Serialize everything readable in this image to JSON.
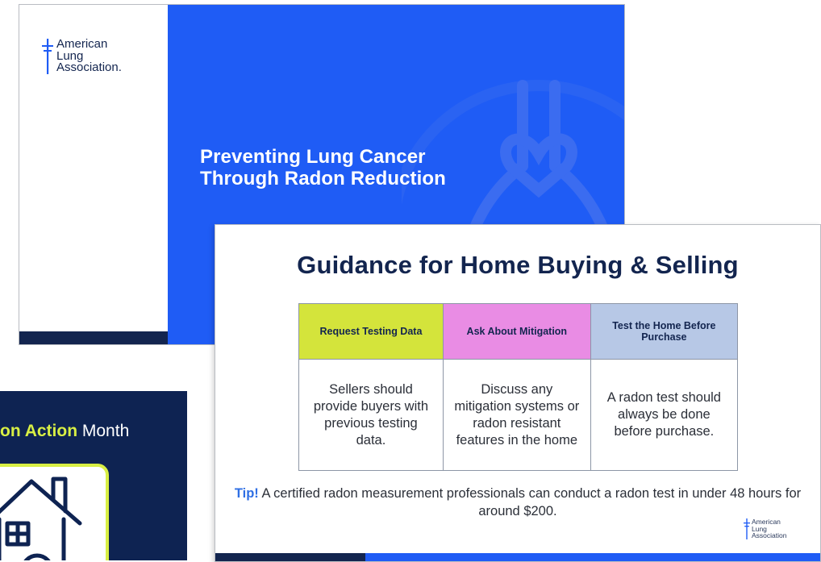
{
  "colors": {
    "brand_blue": "#1f5cf5",
    "navy": "#13254f",
    "lime": "#d8ef44",
    "col_green": "#d4e43b",
    "col_pink": "#e98ce4",
    "col_blue": "#b7c8e6",
    "tip_blue": "#2f6fe4"
  },
  "logo": {
    "line1": "American",
    "line2": "Lung",
    "line3": "Association.",
    "icon": "double-cross-icon"
  },
  "slide1": {
    "title_line1": "Preventing Lung Cancer",
    "title_line2": "Through Radon Reduction",
    "art_icon": "lungs-heart-icon"
  },
  "slide2": {
    "title": "Guidance for Home Buying & Selling",
    "columns": [
      {
        "header": "Request Testing Data",
        "body": "Sellers should provide buyers with previous testing data."
      },
      {
        "header": "Ask About Mitigation",
        "body": "Discuss any mitigation systems or radon resistant features in the home"
      },
      {
        "header": "Test the Home Before Purchase",
        "body": "A radon test should always be done before purchase."
      }
    ],
    "tip_label": "Tip!",
    "tip_text": " A certified radon measurement professionals can conduct a radon test in under 48 hours for around $200.",
    "logo_line1": "American",
    "logo_line2": "Lung",
    "logo_line3": "Association"
  },
  "slide3": {
    "heading_highlight": "on Action",
    "heading_rest": " Month",
    "art_icon": "house-icon"
  }
}
